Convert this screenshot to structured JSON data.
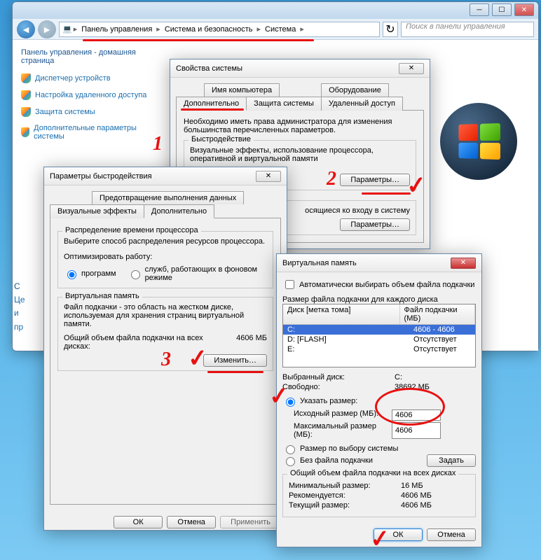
{
  "main": {
    "breadcrumb": [
      "Панель управления",
      "Система и безопасность",
      "Система"
    ],
    "search_placeholder": "Поиск в панели управления",
    "sidebar_title": "Панель управления - домашняя страница",
    "links": [
      "Диспетчер устройств",
      "Настройка удаленного доступа",
      "Защита системы",
      "Дополнительные параметры системы"
    ]
  },
  "sys_props": {
    "title": "Свойства системы",
    "tabs_row1": [
      "Имя компьютера",
      "Оборудование"
    ],
    "tabs_row2": [
      "Дополнительно",
      "Защита системы",
      "Удаленный доступ"
    ],
    "note": "Необходимо иметь права администратора для изменения большинства перечисленных параметров.",
    "perf_title": "Быстродействие",
    "perf_desc": "Визуальные эффекты, использование процессора, оперативной и виртуальной памяти",
    "params_btn": "Параметры…",
    "profiles_desc": "осящиеся ко входу в систему",
    "params_btn2": "Параметры…"
  },
  "perf_opts": {
    "title": "Параметры быстродействия",
    "tabs_row1": [
      "Предотвращение выполнения данных"
    ],
    "tabs_row2": [
      "Визуальные эффекты",
      "Дополнительно"
    ],
    "sched_title": "Распределение времени процессора",
    "sched_desc": "Выберите способ распределения ресурсов процессора.",
    "opt_label": "Оптимизировать работу:",
    "opt_programs": "программ",
    "opt_services": "служб, работающих в фоновом режиме",
    "vm_title": "Виртуальная память",
    "vm_desc": "Файл подкачки - это область на жестком диске, используемая для хранения страниц виртуальной памяти.",
    "vm_total_label": "Общий объем файла подкачки на всех дисках:",
    "vm_total_value": "4606 МБ",
    "change_btn": "Изменить…",
    "ok": "ОК",
    "cancel": "Отмена",
    "apply": "Применить"
  },
  "vm": {
    "title": "Виртуальная память",
    "auto_label": "Автоматически выбирать объем файла подкачки",
    "per_disk_label": "Размер файла подкачки для каждого диска",
    "col_disk": "Диск [метка тома]",
    "col_pf": "Файл подкачки (МБ)",
    "rows": [
      {
        "drive": "C:",
        "pf": "4606 - 4606"
      },
      {
        "drive": "D:    [FLASH]",
        "pf": "Отсутствует"
      },
      {
        "drive": "E:",
        "pf": "Отсутствует"
      }
    ],
    "sel_disk_label": "Выбранный диск:",
    "sel_disk": "C:",
    "free_label": "Свободно:",
    "free": "38692 МБ",
    "custom": "Указать размер:",
    "init_label": "Исходный размер (МБ):",
    "init_val": "4606",
    "max_label": "Максимальный размер (МБ):",
    "max_val": "4606",
    "system_managed": "Размер по выбору системы",
    "no_pf": "Без файла подкачки",
    "set_btn": "Задать",
    "total_title": "Общий объем файла подкачки на всех дисках",
    "min_label": "Минимальный размер:",
    "min": "16 МБ",
    "rec_label": "Рекомендуется:",
    "rec": "4606 МБ",
    "cur_label": "Текущий размер:",
    "cur": "4606 МБ",
    "ok": "ОК",
    "cancel": "Отмена"
  },
  "frag": [
    "С",
    "Це",
    "и",
    "пр"
  ]
}
